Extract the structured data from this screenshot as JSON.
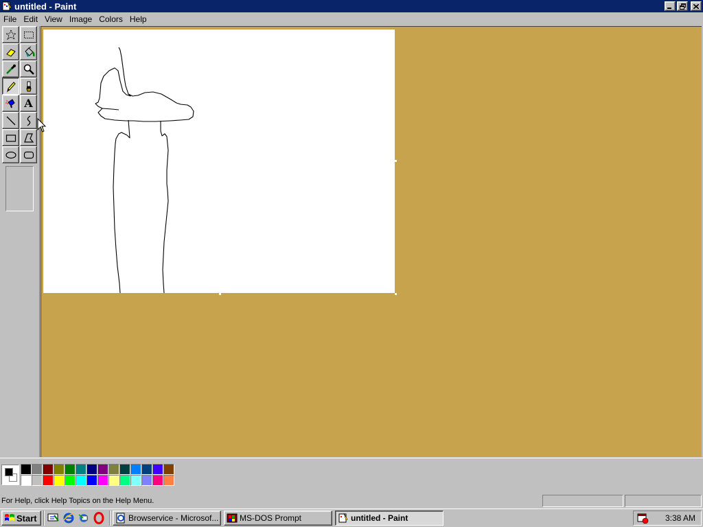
{
  "window": {
    "title": "untitled - Paint"
  },
  "menubar": {
    "items": [
      "File",
      "Edit",
      "View",
      "Image",
      "Colors",
      "Help"
    ]
  },
  "toolbox": {
    "tools": [
      {
        "name": "free-form-select",
        "icon": "star-select-icon",
        "selected": false
      },
      {
        "name": "select",
        "icon": "rect-select-icon",
        "selected": false
      },
      {
        "name": "eraser",
        "icon": "eraser-icon",
        "selected": false
      },
      {
        "name": "fill-with-color",
        "icon": "paint-bucket-icon",
        "selected": false
      },
      {
        "name": "pick-color",
        "icon": "eyedropper-icon",
        "selected": false
      },
      {
        "name": "magnifier",
        "icon": "magnifier-icon",
        "selected": false
      },
      {
        "name": "pencil",
        "icon": "pencil-icon",
        "selected": true
      },
      {
        "name": "brush",
        "icon": "brush-icon",
        "selected": false
      },
      {
        "name": "airbrush",
        "icon": "airbrush-icon",
        "selected": false
      },
      {
        "name": "text",
        "icon": "text-icon",
        "selected": false
      },
      {
        "name": "line",
        "icon": "line-icon",
        "selected": false
      },
      {
        "name": "curve",
        "icon": "curve-icon",
        "selected": false
      },
      {
        "name": "rectangle",
        "icon": "rectangle-icon",
        "selected": false
      },
      {
        "name": "polygon",
        "icon": "polygon-icon",
        "selected": false
      },
      {
        "name": "ellipse",
        "icon": "ellipse-icon",
        "selected": false
      },
      {
        "name": "rounded-rectangle",
        "icon": "rounded-rect-icon",
        "selected": false
      }
    ],
    "text_tool_glyph": "A"
  },
  "palette": {
    "foreground": "#000000",
    "background": "#ffffff",
    "colors": [
      "#000000",
      "#808080",
      "#800000",
      "#808000",
      "#008000",
      "#008080",
      "#000080",
      "#800080",
      "#808040",
      "#004040",
      "#0080ff",
      "#004080",
      "#4000ff",
      "#804000",
      "#ffffff",
      "#c0c0c0",
      "#ff0000",
      "#ffff00",
      "#00ff00",
      "#00ffff",
      "#0000ff",
      "#ff00ff",
      "#ffff80",
      "#00ff80",
      "#80ffff",
      "#8080ff",
      "#ff0080",
      "#ff8040"
    ]
  },
  "statusbar": {
    "help_text": "For Help, click Help Topics on the Help Menu."
  },
  "taskbar": {
    "start_label": "Start",
    "quick_launch": [
      "show-desktop-icon",
      "internet-explorer-icon",
      "outlook-express-icon",
      "opera-icon"
    ],
    "tasks": [
      {
        "label": "Browservice - Microsof...",
        "icon": "ie-page-icon",
        "active": false
      },
      {
        "label": "MS-DOS Prompt",
        "icon": "msdos-icon",
        "active": false
      },
      {
        "label": "untitled - Paint",
        "icon": "paint-icon",
        "active": true
      }
    ],
    "clock": "3:38 AM"
  },
  "colors": {
    "titlebar": "#0a246a",
    "workspace": "#c8a34e",
    "face": "#c0c0c0"
  }
}
